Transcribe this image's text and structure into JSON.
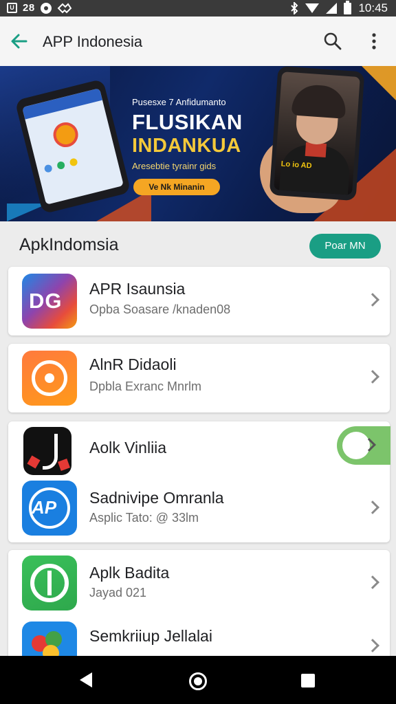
{
  "status_bar": {
    "left_box": "U",
    "left_text": "28",
    "time": "10:45",
    "icons": [
      "app-badge-icon",
      "record-icon",
      "link-icon",
      "bluetooth-icon",
      "wifi-icon",
      "signal-icon",
      "battery-icon"
    ]
  },
  "app_bar": {
    "title": "APP Indonesia",
    "icons": [
      "back-arrow-icon",
      "search-icon",
      "more-vert-icon"
    ],
    "accent": "#1a9e84"
  },
  "banner": {
    "headline": "Pusesxe 7 Anfidumanto",
    "title_line1": "FLUSIKAN",
    "title_line2": "INDANKUA",
    "subtitle": "Aresebtie tyrainr gids",
    "button": "Ve Nk Minanin",
    "phone_caption": "Lo io AD",
    "colors": {
      "title1": "#ffffff",
      "title2": "#f4c93a",
      "button": "#f5a623"
    }
  },
  "section": {
    "title": "ApkIndomsia",
    "button": "Poar MN"
  },
  "apps": [
    {
      "name": "APR Isaunsia",
      "subtitle": "Opba Soasare /knaden08",
      "icon_label": "DG",
      "icon": "dg-app-icon"
    },
    {
      "name": "AlnR Didaoli",
      "subtitle": "Dpbla Exranc Mnrlm",
      "icon_label": "",
      "icon": "orange-camera-icon"
    },
    {
      "name": "Aolk Vinliia",
      "subtitle": "",
      "icon_label": "",
      "icon": "tiktok-style-icon"
    },
    {
      "name": "Sadnivipe Omranla",
      "subtitle": "Asplic Tato: @ 33lm",
      "icon_label": "AP",
      "icon": "ap-app-icon"
    },
    {
      "name": "Aplk Badita",
      "subtitle": "Jayad 021",
      "icon_label": "",
      "icon": "green-app-icon"
    },
    {
      "name": "Semkriiup Jellalai",
      "subtitle": "",
      "icon_label": "",
      "icon": "pinwheel-app-icon"
    }
  ],
  "nav_bar": {
    "icons": [
      "nav-back-icon",
      "nav-home-icon",
      "nav-recents-icon"
    ]
  }
}
